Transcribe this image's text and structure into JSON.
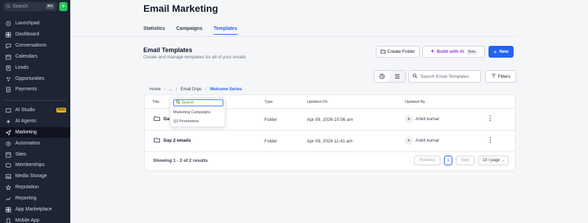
{
  "sidebar": {
    "search_placeholder": "Search",
    "search_shortcut": "⌘K",
    "plus_label": "+",
    "items": [
      {
        "label": "Launchpad",
        "icon": "rocket-icon"
      },
      {
        "label": "Dashboard",
        "icon": "grid-icon"
      },
      {
        "label": "Conversations",
        "icon": "chat-icon"
      },
      {
        "label": "Calendars",
        "icon": "calendar-icon"
      },
      {
        "label": "Leads",
        "icon": "contacts-icon"
      },
      {
        "label": "Opportunities",
        "icon": "funnel-icon"
      },
      {
        "label": "Payments",
        "icon": "payment-icon"
      },
      {
        "label": "AI Studio",
        "icon": "ai-studio-icon",
        "badge": "Beta"
      },
      {
        "label": "AI Agents",
        "icon": "sparkle-icon"
      },
      {
        "label": "Marketing",
        "icon": "send-icon",
        "active": true
      },
      {
        "label": "Automation",
        "icon": "automation-icon"
      },
      {
        "label": "Sites",
        "icon": "globe-icon"
      },
      {
        "label": "Memberships",
        "icon": "membership-icon"
      },
      {
        "label": "Media Storage",
        "icon": "media-icon"
      },
      {
        "label": "Reputation",
        "icon": "star-icon"
      },
      {
        "label": "Reporting",
        "icon": "chart-icon"
      },
      {
        "label": "App Marketplace",
        "icon": "apps-icon"
      },
      {
        "label": "Mobile App",
        "icon": "mobile-icon"
      }
    ]
  },
  "header": {
    "title": "Email Marketing",
    "tabs": [
      {
        "label": "Statistics"
      },
      {
        "label": "Campaigns"
      },
      {
        "label": "Templates",
        "active": true
      }
    ]
  },
  "section": {
    "title": "Email Templates",
    "subtitle": "Create and manage templates for all of your emails"
  },
  "actions": {
    "create_folder": "Create Folder",
    "build_ai": "Build with AI",
    "beta": "Beta",
    "new": "New"
  },
  "toolbar": {
    "search_placeholder": "Search Email Templates",
    "filters": "Filters"
  },
  "breadcrumb": {
    "items": [
      "Home",
      "...",
      "Email Drips"
    ],
    "current": "Welcome Series",
    "separator": "/"
  },
  "table": {
    "columns": [
      "Title",
      "Type",
      "Updated On",
      "Updated By"
    ],
    "rows": [
      {
        "title": "Day 1 emails",
        "title_visible": "Day",
        "type": "Folder",
        "updated_on": "Apr 09, 2026 10:56 am",
        "avatar": "A",
        "updated_by": "Ankit kumar"
      },
      {
        "title": "Day 2 emails",
        "type": "Folder",
        "updated_on": "Apr 09, 2026 11:41 am",
        "avatar": "A",
        "updated_by": "Ankit kumar"
      }
    ],
    "footer": "Showing 1 - 2 of 2 results",
    "pagination": {
      "previous": "Previous",
      "page": "1",
      "next": "Next",
      "per_page": "10 / page"
    }
  },
  "folder_dropdown": {
    "search_placeholder": "Search",
    "items": [
      "Marketing Campaigns",
      "Q2 Promotions"
    ]
  },
  "colors": {
    "primary": "#2563eb",
    "sidebar": "#1e2433",
    "ai": "#9333ea",
    "success": "#22c55e"
  }
}
